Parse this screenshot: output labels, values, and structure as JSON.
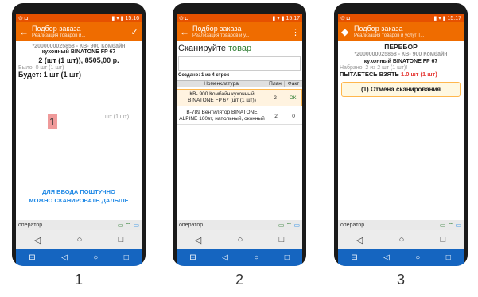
{
  "accent_color": "#ef6c00",
  "phones": [
    {
      "status_time": "15:16",
      "title": "Подбор заказа",
      "subtitle": "Реализация товаров и...",
      "product_line1": "*2000000025858 - КВ- 900 Комбайн",
      "product_line2": "кухонный BINATONE FP 67",
      "qty_line": "2 (шт (1 шт)), 8505,00 р.",
      "was_line": "Было: 0 шт (1 шт)",
      "will_be_line": "Будет: 1 шт (1 шт)",
      "input_value": "1",
      "unit_label": "шт (1 шт)",
      "hint_line1": "ДЛЯ ВВОДА ПОШТУЧНО",
      "hint_line2": "МОЖНО СКАНИРОВАТЬ ДАЛЬШЕ",
      "operator_label": "оператор"
    },
    {
      "status_time": "15:17",
      "title": "Подбор заказа",
      "subtitle": "Реализация товаров и у...",
      "scan_prompt_a": "Сканируйте",
      "scan_prompt_b": "товар",
      "rows_count": "Создано: 1 из 4 строк",
      "headers": [
        "Номенклатура",
        "План",
        "Факт"
      ],
      "rows": [
        {
          "name": "КВ- 900 Комбайн кухонный BINATONE FP 67 (шт (1 шт))",
          "plan": "2",
          "fact": "ОК"
        },
        {
          "name": "В-789 Вентилятор BINATONE ALPINE 160вт, напольный, оконный",
          "plan": "2",
          "fact": "0"
        }
      ],
      "operator_label": "оператор"
    },
    {
      "status_time": "15:17",
      "title": "Подбор заказа",
      "subtitle": "Реализация товаров и услуг Т...",
      "warning_title": "ПЕРЕБОР",
      "product_line1": "*2000000025858 - КВ- 900 Комбайн",
      "product_line2": "кухонный BINATONE FP 67",
      "collected_line": "Набрано: 2 из 2 шт (1 шт)!",
      "attempt_prefix": "ПЫТАЕТЕСЬ ВЗЯТЬ",
      "attempt_value": "1.0 шт (1 шт)",
      "cancel_button": "(1) Отмена сканирования",
      "operator_label": "оператор"
    }
  ],
  "captions": [
    "1",
    "2",
    "3"
  ]
}
